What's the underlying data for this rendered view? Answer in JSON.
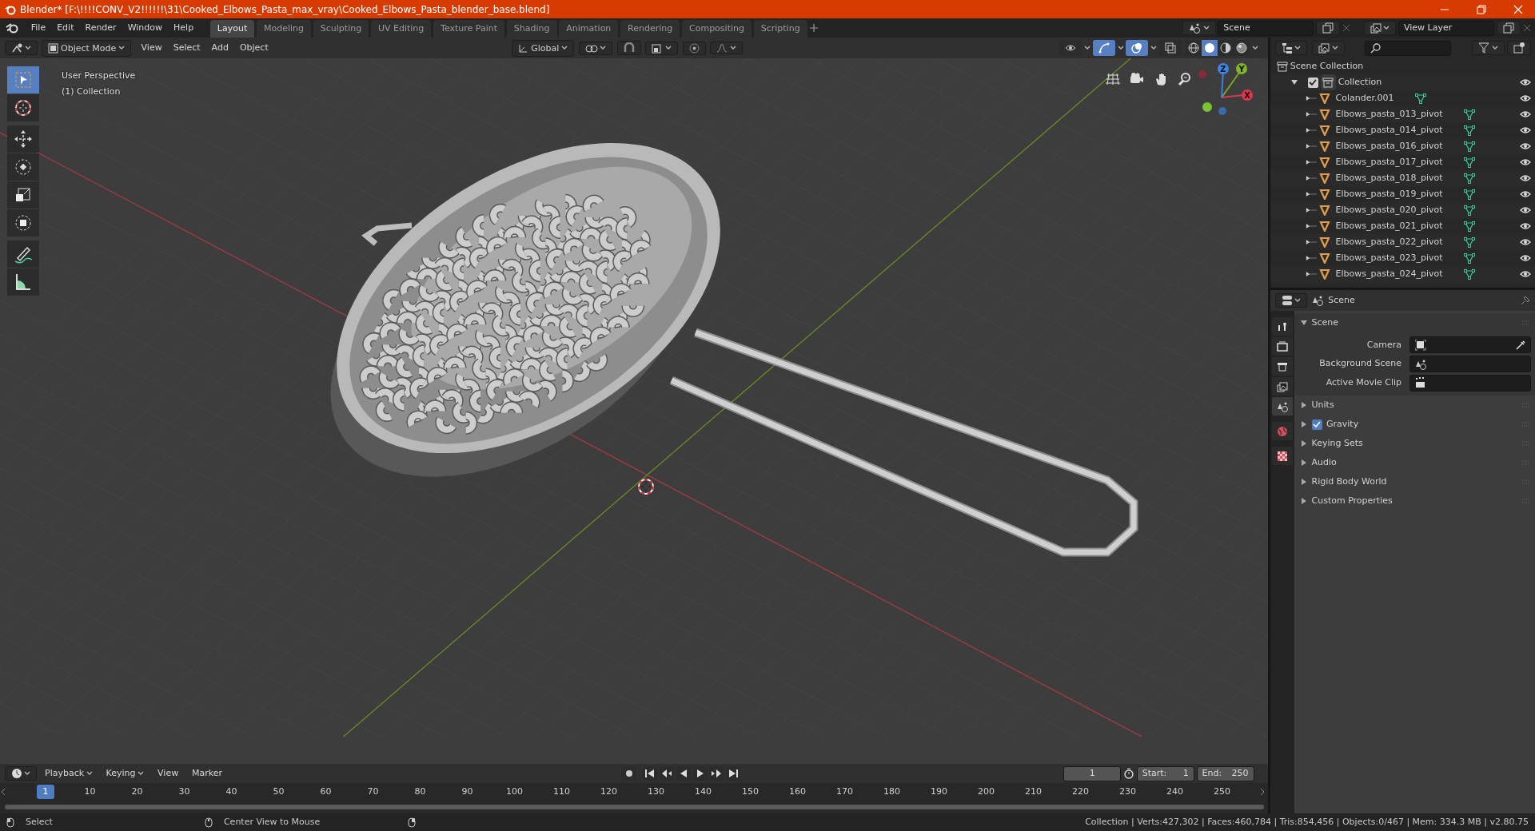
{
  "window": {
    "title": "Blender* [F:\\!!!!CONV_V2!!!!!!\\31\\Cooked_Elbows_Pasta_max_vray\\Cooked_Elbows_Pasta_blender_base.blend]"
  },
  "menu": [
    "File",
    "Edit",
    "Render",
    "Window",
    "Help"
  ],
  "workspaces": [
    {
      "label": "Layout",
      "selected": true
    },
    {
      "label": "Modeling",
      "selected": false
    },
    {
      "label": "Sculpting",
      "selected": false
    },
    {
      "label": "UV Editing",
      "selected": false
    },
    {
      "label": "Texture Paint",
      "selected": false
    },
    {
      "label": "Shading",
      "selected": false
    },
    {
      "label": "Animation",
      "selected": false
    },
    {
      "label": "Rendering",
      "selected": false
    },
    {
      "label": "Compositing",
      "selected": false
    },
    {
      "label": "Scripting",
      "selected": false
    }
  ],
  "scene": "Scene",
  "view_layer": "View Layer",
  "viewport": {
    "mode": "Object Mode",
    "menus": [
      "View",
      "Select",
      "Add",
      "Object"
    ],
    "orientation": "Global",
    "toggles": [
      {
        "kind": "visibility",
        "on": false
      },
      {
        "kind": "gizmo",
        "on": true
      },
      {
        "kind": "overlay",
        "on": true
      },
      {
        "kind": "xray",
        "on": false
      }
    ],
    "shading_modes": [
      {
        "kind": "wireframe",
        "selected": false
      },
      {
        "kind": "solid",
        "selected": true
      },
      {
        "kind": "material",
        "selected": false
      },
      {
        "kind": "rendered",
        "selected": false
      }
    ],
    "overlay_lines": [
      "User Perspective",
      "(1) Collection"
    ],
    "tools": [
      {
        "kind": "select",
        "selected": true
      },
      {
        "kind": "cursor",
        "selected": false
      },
      {
        "kind": "move",
        "selected": false
      },
      {
        "kind": "rotate",
        "selected": false
      },
      {
        "kind": "scale",
        "selected": false
      },
      {
        "kind": "transform",
        "selected": false
      },
      {
        "kind": "annotate",
        "selected": false
      },
      {
        "kind": "measure",
        "selected": false
      }
    ],
    "gizmo_axes": [
      "X",
      "Y",
      "Z"
    ]
  },
  "outliner": {
    "items": [
      {
        "label": "Scene Collection",
        "kind": "scene_collection",
        "children": [
          {
            "label": "Collection",
            "kind": "collection",
            "checked": true,
            "expanded": true,
            "children": [
              {
                "label": "Colander.001",
                "kind": "object"
              },
              {
                "label": "Elbows_pasta_013_pivot",
                "kind": "object"
              },
              {
                "label": "Elbows_pasta_014_pivot",
                "kind": "object"
              },
              {
                "label": "Elbows_pasta_016_pivot",
                "kind": "object"
              },
              {
                "label": "Elbows_pasta_017_pivot",
                "kind": "object"
              },
              {
                "label": "Elbows_pasta_018_pivot",
                "kind": "object"
              },
              {
                "label": "Elbows_pasta_019_pivot",
                "kind": "object"
              },
              {
                "label": "Elbows_pasta_020_pivot",
                "kind": "object"
              },
              {
                "label": "Elbows_pasta_021_pivot",
                "kind": "object"
              },
              {
                "label": "Elbows_pasta_022_pivot",
                "kind": "object"
              },
              {
                "label": "Elbows_pasta_023_pivot",
                "kind": "object"
              },
              {
                "label": "Elbows_pasta_024_pivot",
                "kind": "object"
              }
            ]
          }
        ]
      }
    ]
  },
  "properties": {
    "header": "Scene",
    "tabs": [
      {
        "kind": "tool",
        "selected": false
      },
      {
        "kind": "render",
        "selected": false
      },
      {
        "kind": "output",
        "selected": false
      },
      {
        "kind": "view_layer",
        "selected": false
      },
      {
        "kind": "scene",
        "selected": true
      },
      {
        "kind": "world",
        "selected": false
      },
      {
        "kind": "texture",
        "selected": false
      }
    ],
    "panels": [
      {
        "label": "Scene",
        "expanded": true,
        "fields": [
          {
            "label": "Camera",
            "kind": "camera"
          },
          {
            "label": "Background Scene",
            "kind": "scene"
          },
          {
            "label": "Active Movie Clip",
            "kind": "clip"
          }
        ]
      },
      {
        "label": "Units",
        "expanded": false
      },
      {
        "label": "Gravity",
        "expanded": false,
        "kind": "checkbox",
        "checked": true
      },
      {
        "label": "Keying Sets",
        "expanded": false
      },
      {
        "label": "Audio",
        "expanded": false
      },
      {
        "label": "Rigid Body World",
        "expanded": false
      },
      {
        "label": "Custom Properties",
        "expanded": false
      }
    ]
  },
  "timeline": {
    "menus": [
      {
        "label": "Playback",
        "dropdown": true
      },
      {
        "label": "Keying",
        "dropdown": true
      },
      {
        "label": "View",
        "dropdown": false
      },
      {
        "label": "Marker",
        "dropdown": false
      }
    ],
    "current_frame": "1",
    "start_label": "Start:",
    "start": "1",
    "end_label": "End:",
    "end": "250",
    "playhead": "1",
    "ticks": [
      "10",
      "20",
      "30",
      "40",
      "50",
      "60",
      "70",
      "80",
      "90",
      "100",
      "110",
      "120",
      "130",
      "140",
      "150",
      "160",
      "170",
      "180",
      "190",
      "200",
      "210",
      "220",
      "230",
      "240",
      "250"
    ]
  },
  "status_bar": {
    "hints": [
      "Select",
      "Center View to Mouse"
    ],
    "stats": "Collection | Verts:427,302 | Faces:460,784 | Tris:854,456 | Objects:0/467 | Mem: 334.3 MB | v2.80.75"
  }
}
